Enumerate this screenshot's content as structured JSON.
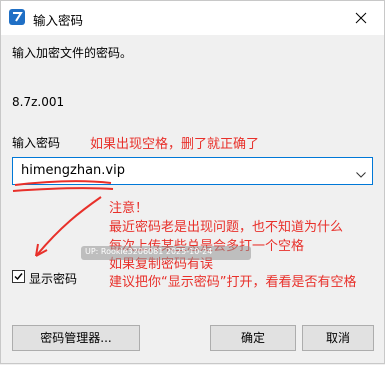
{
  "window": {
    "title": "输入密码",
    "close_label": "✕"
  },
  "prompt": "输入加密文件的密码。",
  "archive_name": "8.7z.001",
  "password_label": "输入密码",
  "password_value": "himengzhan.vip",
  "annotations": {
    "note_top": "如果出现空格，删了就正确了",
    "attention": "注意！",
    "line1": "最近密码老是出现问题，也不知道为什么",
    "line2": "每次上传某些总是会多打一个空格",
    "line3": "如果复制密码有误",
    "line4": "建议把你“显示密码”打开，看看是否有空格"
  },
  "watermark": "UP: Rookie3206081  2025-10-24",
  "show_password": {
    "label": "显示密码",
    "checked": true
  },
  "buttons": {
    "manager": "密码管理器...",
    "ok": "确定",
    "cancel": "取消"
  },
  "colors": {
    "annotation": "#e8302a",
    "focus_border": "#0078d7"
  },
  "icons": {
    "app": "7zip-app-icon",
    "close": "close-icon",
    "dropdown": "chevron-down-icon",
    "check": "check-icon"
  }
}
